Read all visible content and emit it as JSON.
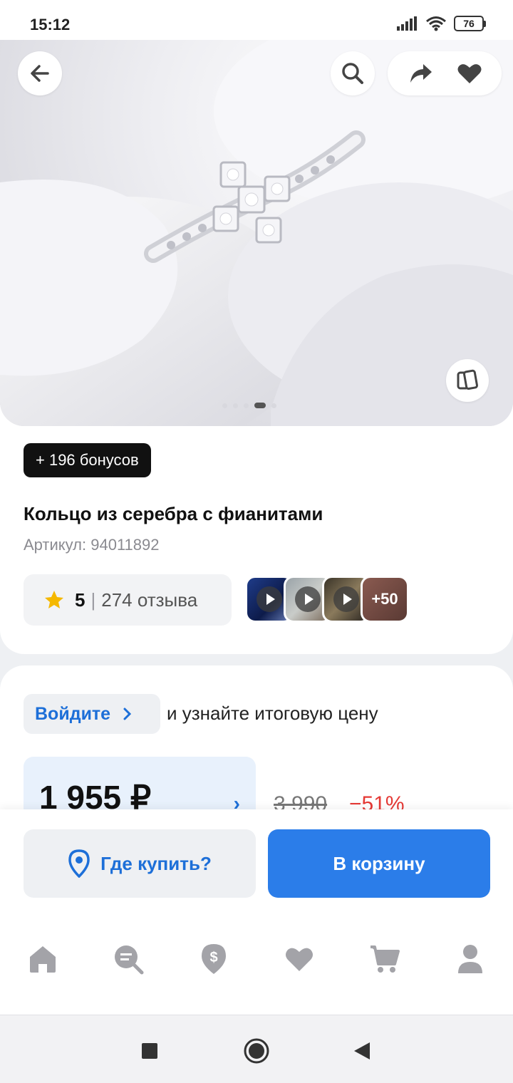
{
  "status_bar": {
    "time": "15:12",
    "battery": "76"
  },
  "product": {
    "bonus": "+ 196 бонусов",
    "title": "Кольцо из серебра с фианитами",
    "sku": "Артикул: 94011892",
    "rating_value": "5",
    "rating_separator": "|",
    "reviews": "274 отзыва",
    "media_more": "+50",
    "images_total": 5,
    "current_image_index": 4
  },
  "pricing": {
    "login_label": "Войдите",
    "login_hint": "и узнайте итоговую цену",
    "price": "1 955 ₽",
    "old_price": "3 990",
    "discount": "−51%"
  },
  "actions": {
    "where_to_buy": "Где купить?",
    "add_to_cart": "В корзину"
  },
  "tabs": [
    "home-icon",
    "catalog-search-icon",
    "offers-icon",
    "favorites-icon",
    "cart-icon",
    "profile-icon"
  ],
  "colors": {
    "accent": "#2b7de9",
    "discount": "#e53935",
    "badge": "#111111",
    "rating_star": "#f5b800"
  }
}
